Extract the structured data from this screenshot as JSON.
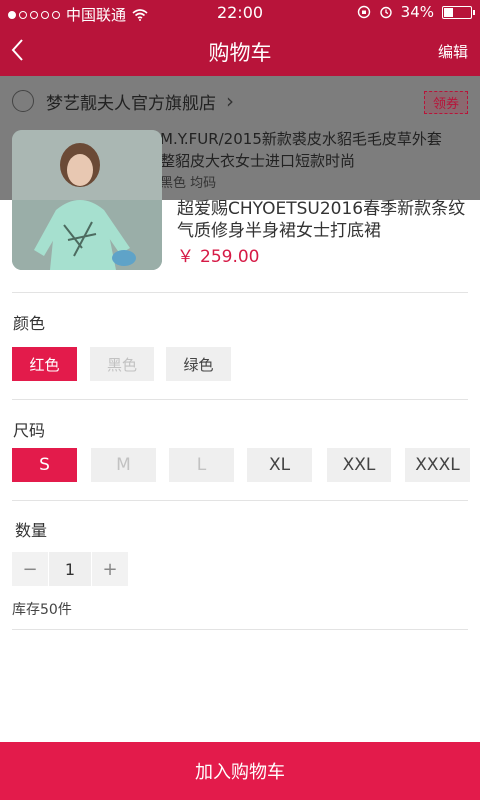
{
  "status_bar": {
    "carrier": "中国联通",
    "time": "22:00",
    "battery": "34%",
    "battery_level": 0.34
  },
  "nav": {
    "back_icon": "chevron-left-icon",
    "title": "购物车",
    "edit_label": "编辑"
  },
  "background_cart": {
    "store_name": "梦艺靓夫人官方旗舰店",
    "coupon_label": "领券",
    "item_title_line1": "M.Y.FUR/2015新款裘皮水貂毛毛皮草外套",
    "item_title_line2": "整貂皮大衣女士进口短款时尚",
    "item_spec": "黑色  均码"
  },
  "product": {
    "title": "超爱赐CHYOETSU2016春季新款条纹气质修身半身裙女士打底裙",
    "currency": "￥",
    "price": "259.00"
  },
  "color_section": {
    "label": "颜色",
    "options": [
      {
        "label": "红色",
        "state": "selected"
      },
      {
        "label": "黑色",
        "state": "disabled"
      },
      {
        "label": "绿色",
        "state": "normal"
      }
    ]
  },
  "size_section": {
    "label": "尺码",
    "options": [
      {
        "label": "S",
        "state": "selected"
      },
      {
        "label": "M",
        "state": "disabled"
      },
      {
        "label": "L",
        "state": "disabled"
      },
      {
        "label": "XL",
        "state": "normal"
      },
      {
        "label": "XXL",
        "state": "normal"
      },
      {
        "label": "XXXL",
        "state": "normal"
      }
    ]
  },
  "quantity_section": {
    "label": "数量",
    "minus": "−",
    "value": "1",
    "plus": "+",
    "stock": "库存50件"
  },
  "add_to_cart_label": "加入购物车",
  "colors": {
    "brand": "#b8143a",
    "accent": "#e31b4b",
    "price": "#d61a46"
  }
}
